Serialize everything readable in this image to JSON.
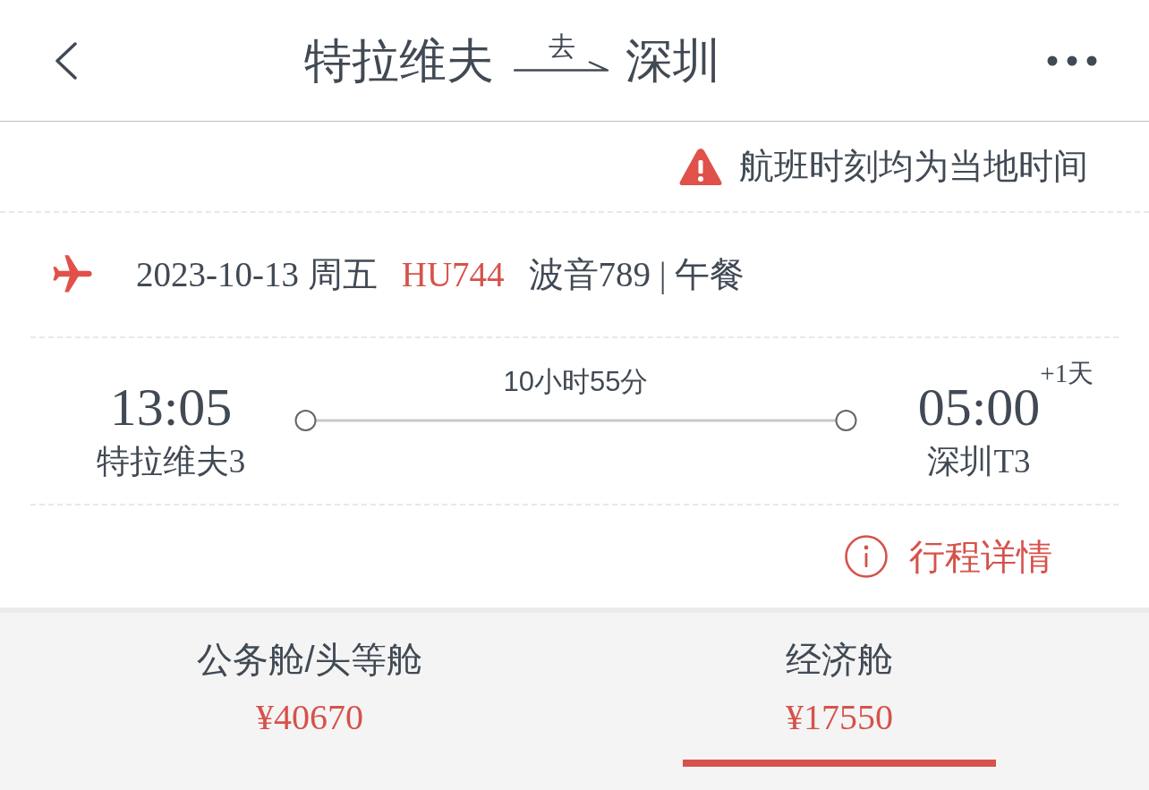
{
  "header": {
    "origin": "特拉维夫",
    "direction": "去",
    "destination": "深圳"
  },
  "notice": {
    "text": "航班时刻均为当地时间"
  },
  "flight": {
    "date": "2023-10-13 周五",
    "flight_no": "HU744",
    "aircraft_meal": "波音789 | 午餐"
  },
  "schedule": {
    "departure": {
      "time": "13:05",
      "airport": "特拉维夫3"
    },
    "duration": "10小时55分",
    "arrival": {
      "time": "05:00",
      "day_offset": "+1天",
      "airport": "深圳T3"
    }
  },
  "details_link": "行程详情",
  "cabins": [
    {
      "name": "公务舱/头等舱",
      "price": "¥40670",
      "selected": false
    },
    {
      "name": "经济舱",
      "price": "¥17550",
      "selected": true
    }
  ]
}
